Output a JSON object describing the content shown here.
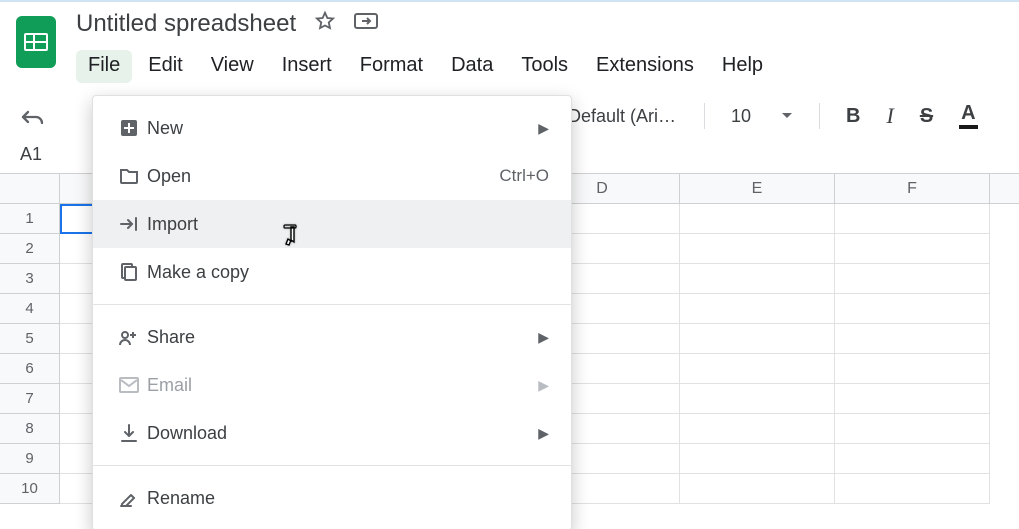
{
  "doc_title": "Untitled spreadsheet",
  "menubar": {
    "file": "File",
    "edit": "Edit",
    "view": "View",
    "insert": "Insert",
    "format": "Format",
    "data": "Data",
    "tools": "Tools",
    "extensions": "Extensions",
    "help": "Help"
  },
  "toolbar": {
    "font_name": "Default (Ari…",
    "font_size": "10"
  },
  "name_box": "A1",
  "columns": [
    "D",
    "E",
    "F"
  ],
  "rows": [
    "1",
    "2",
    "3",
    "4",
    "5",
    "6",
    "7",
    "8",
    "9",
    "10"
  ],
  "file_menu": {
    "new": "New",
    "open": {
      "label": "Open",
      "shortcut": "Ctrl+O"
    },
    "import": "Import",
    "make_copy": "Make a copy",
    "share": "Share",
    "email": "Email",
    "download": "Download",
    "rename": "Rename"
  }
}
